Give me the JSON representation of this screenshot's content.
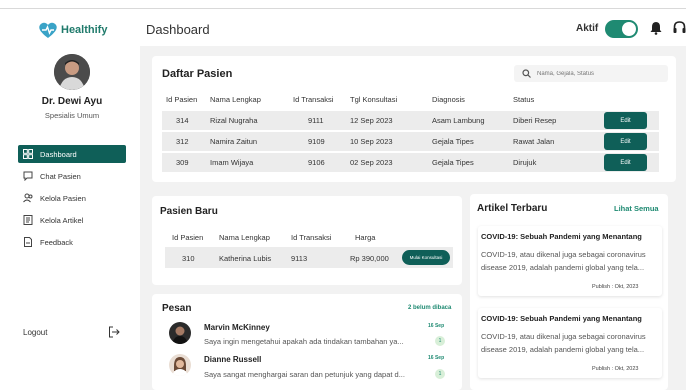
{
  "brand": {
    "name": "Healthify",
    "color": "#1f7a6b"
  },
  "doctor": {
    "name": "Dr. Dewi Ayu",
    "role": "Spesialis Umum"
  },
  "nav": [
    {
      "label": "Dashboard",
      "icon": "dashboard-icon",
      "active": true
    },
    {
      "label": "Chat Pasien",
      "icon": "chat-icon",
      "active": false
    },
    {
      "label": "Kelola Pasien",
      "icon": "users-icon",
      "active": false
    },
    {
      "label": "Kelola Artikel",
      "icon": "article-icon",
      "active": false
    },
    {
      "label": "Feedback",
      "icon": "feedback-icon",
      "active": false
    }
  ],
  "logout_label": "Logout",
  "header": {
    "title": "Dashboard",
    "status_label": "Aktif",
    "status_on": true
  },
  "colors": {
    "accent": "#0f5f58",
    "accent_light": "#1f8a72"
  },
  "daftar_pasien": {
    "title": "Daftar Pasien",
    "search_placeholder": "Nama, Gejala, Status",
    "columns": [
      "Id Pasien",
      "Nama Lengkap",
      "Id Transaksi",
      "Tgl Konsultasi",
      "Diagnosis",
      "Status"
    ],
    "rows": [
      {
        "id": "314",
        "nama": "Rizal Nugraha",
        "transaksi": "9111",
        "tgl": "12 Sep 2023",
        "diagnosis": "Asam Lambung",
        "status": "Diberi Resep",
        "action": "Edit"
      },
      {
        "id": "312",
        "nama": "Namira Zaitun",
        "transaksi": "9109",
        "tgl": "10 Sep 2023",
        "diagnosis": "Gejala Tipes",
        "status": "Rawat Jalan",
        "action": "Edit"
      },
      {
        "id": "309",
        "nama": "Imam Wijaya",
        "transaksi": "9106",
        "tgl": "02 Sep 2023",
        "diagnosis": "Gejala Tipes",
        "status": "Dirujuk",
        "action": "Edit"
      }
    ]
  },
  "pasien_baru": {
    "title": "Pasien Baru",
    "columns": [
      "Id Pasien",
      "Nama Lengkap",
      "Id Transaksi",
      "Harga"
    ],
    "rows": [
      {
        "id": "310",
        "nama": "Katherina Lubis",
        "transaksi": "9113",
        "harga": "Rp 390,000",
        "action": "Mulai Konsultasi"
      }
    ]
  },
  "pesan": {
    "title": "Pesan",
    "unread_label": "2 belum dibaca",
    "messages": [
      {
        "name": "Marvin McKinney",
        "text": "Saya ingin mengetahui apakah ada tindakan tambahan ya...",
        "date": "16 Sep",
        "badge": "1"
      },
      {
        "name": "Dianne Russell",
        "text": "Saya sangat menghargai saran dan petunjuk yang dapat d...",
        "date": "16 Sep",
        "badge": "1"
      }
    ]
  },
  "artikel": {
    "title": "Artikel Terbaru",
    "see_all": "Lihat Semua",
    "items": [
      {
        "title": "COVID-19: Sebuah Pandemi yang Menantang",
        "body": "COVID-19, atau dikenal juga sebagai coronavirus disease 2019, adalah pandemi global yang tela...",
        "date": "Publish : Okt, 2023"
      },
      {
        "title": "COVID-19: Sebuah Pandemi yang Menantang",
        "body": "COVID-19, atau dikenal juga sebagai coronavirus disease 2019, adalah pandemi global yang tela...",
        "date": "Publish : Okt, 2023"
      }
    ]
  }
}
